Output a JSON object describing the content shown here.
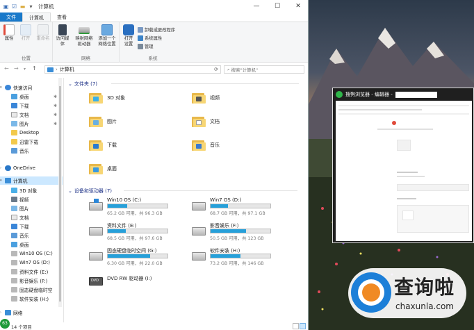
{
  "window": {
    "title": "计算机",
    "controls": {
      "minimize": "—",
      "maximize": "☐",
      "close": "✕"
    }
  },
  "ribbon": {
    "tabs": [
      "文件",
      "计算机",
      "查看"
    ],
    "groups": {
      "location": {
        "label": "位置",
        "buttons": {
          "properties": "属性",
          "open": "打开",
          "rename": "重命名"
        }
      },
      "network": {
        "label": "网络",
        "buttons": {
          "access_media": "访问媒体",
          "map_drive_1": "映射网络",
          "map_drive_2": "驱动器",
          "add_location_1": "添加一个",
          "add_location_2": "网络位置"
        }
      },
      "system": {
        "label": "系统",
        "open_settings_1": "打开",
        "open_settings_2": "设置",
        "uninstall": "卸载或更改程序",
        "sys_props": "系统属性",
        "manage": "管理"
      }
    }
  },
  "address": {
    "path": "计算机",
    "search_placeholder": "搜索\"计算机\""
  },
  "nav": {
    "quick_access": "快速访问",
    "quick_items": [
      "桌面",
      "下载",
      "文档",
      "图片",
      "Desktop",
      "迅雷下载",
      "音乐"
    ],
    "onedrive": "OneDrive",
    "this_pc": "计算机",
    "pc_items": [
      "3D 对象",
      "视频",
      "图片",
      "文档",
      "下载",
      "音乐",
      "桌面",
      "Win10 OS (C:)",
      "Win7 OS (D:)",
      "资料文件 (E:)",
      "影音娱乐 (F:)",
      "固态硬盘临时空",
      "软件安装 (H:)",
      "网络"
    ]
  },
  "sections": {
    "folders": "文件夹 (7)",
    "devices": "设备和驱动器 (7)"
  },
  "folders": [
    "3D 对象",
    "视频",
    "图片",
    "文档",
    "下载",
    "音乐",
    "桌面"
  ],
  "drives": [
    {
      "name": "Win10 OS (C:)",
      "free": "65.2 GB 可用，共 96.3 GB",
      "used_fraction": 0.32
    },
    {
      "name": "Win7 OS (D:)",
      "free": "68.7 GB 可用，共 97.1 GB",
      "used_fraction": 0.29
    },
    {
      "name": "资料文件 (E:)",
      "free": "68.5 GB 可用，共 97.6 GB",
      "used_fraction": 0.3
    },
    {
      "name": "影音娱乐 (F:)",
      "free": "50.5 GB 可用，共 123 GB",
      "used_fraction": 0.59
    },
    {
      "name": "固态硬盘临时空间 (G:)",
      "free": "6.30 GB 可用，共 22.0 GB",
      "used_fraction": 0.71
    },
    {
      "name": "软件安装 (H:)",
      "free": "73.2 GB 可用，共 146 GB",
      "used_fraction": 0.5
    }
  ],
  "dvd": {
    "name": "DVD RW 驱动器 (I:)",
    "icon_label": "DVD"
  },
  "status": {
    "count": "14 个项目",
    "badge": "63"
  },
  "popup": {
    "title": "搜狗浏览器 - 编辑器 -"
  },
  "watermark": {
    "brand": "查询啦",
    "domain": "chaxunla.com"
  }
}
